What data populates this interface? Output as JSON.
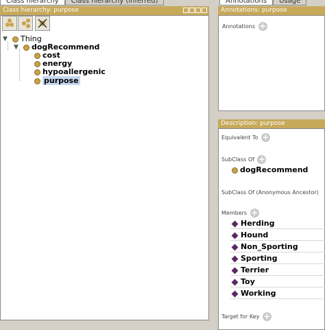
{
  "left_tabs": [
    "Class hierarchy",
    "Class hierarchy (inferred)"
  ],
  "right_tabs": [
    "Annotations",
    "Usage"
  ],
  "class_hierarchy": {
    "header": "Class hierarchy: purpose",
    "tree": {
      "root": "Thing",
      "child": "dogRecommend",
      "leaves": [
        "cost",
        "energy",
        "hypoallergenic",
        "purpose"
      ],
      "selected": "purpose"
    }
  },
  "annotations": {
    "header": "Annotations: purpose",
    "label": "Annotations"
  },
  "description": {
    "header": "Description: purpose",
    "equivalent_to": "Equivalent To",
    "subclass_of": "SubClass Of",
    "subclass_value": "dogRecommend",
    "anon_ancestor": "SubClass Of (Anonymous Ancestor)",
    "members": "Members",
    "member_items": [
      "Herding",
      "Hound",
      "Non_Sporting",
      "Sporting",
      "Terrier",
      "Toy",
      "Working"
    ],
    "target_for_key": "Target for Key"
  },
  "colors": {
    "header_bg": "#c7a95a",
    "class_dot": "#c9a24a",
    "individual": "#5a2a63",
    "selection": "#c6d7ee"
  }
}
